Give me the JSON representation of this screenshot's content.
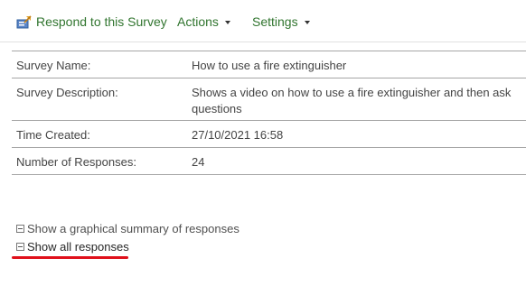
{
  "toolbar": {
    "respond_label": "Respond to this Survey",
    "actions_label": "Actions",
    "settings_label": "Settings",
    "link_color": "#31752f"
  },
  "details": {
    "rows": [
      {
        "label": "Survey Name:",
        "value": "How to use a fire extinguisher"
      },
      {
        "label": "Survey Description:",
        "value": "Shows a video on how to use a fire extinguisher and then ask questions"
      },
      {
        "label": "Time Created:",
        "value": "27/10/2021 16:58"
      },
      {
        "label": "Number of Responses:",
        "value": "24"
      }
    ]
  },
  "links": {
    "summary_label": "Show a graphical summary of responses",
    "all_label": "Show all responses"
  },
  "annotation": {
    "color": "#e0101b"
  }
}
